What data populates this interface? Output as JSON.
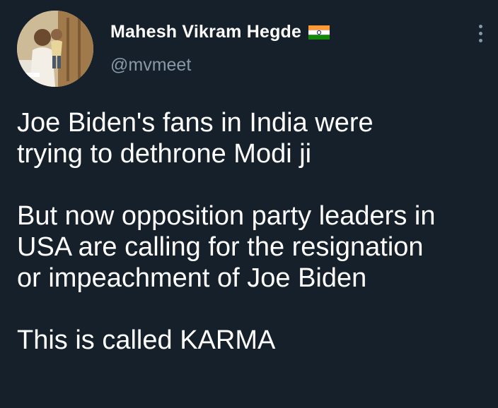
{
  "user": {
    "display_name": "Mahesh Vikram Hegde",
    "handle": "@mvmeet",
    "flag_icon": "india-flag-icon"
  },
  "tweet": {
    "paragraphs": [
      [
        "Joe Biden's fans in India were",
        "trying to dethrone Modi ji"
      ],
      [
        "But now opposition party leaders in",
        "USA are calling for the resignation",
        "or impeachment of Joe Biden"
      ],
      [
        "This is called KARMA"
      ]
    ]
  },
  "colors": {
    "background": "#15202b",
    "text": "#ffffff",
    "secondary_text": "#8899a6",
    "link": "#1da1f2"
  }
}
